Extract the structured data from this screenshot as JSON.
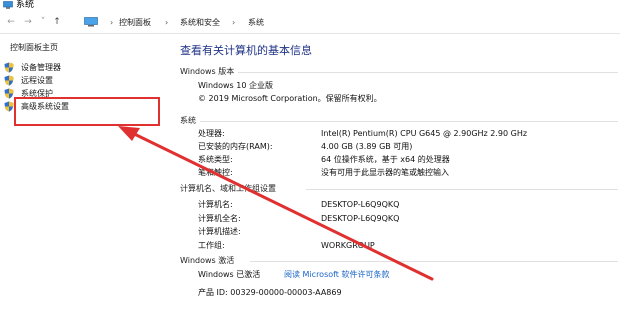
{
  "window": {
    "title": "系统"
  },
  "nav": {
    "back": "←",
    "forward": "→",
    "recent": "˅",
    "up": "↑",
    "breadcrumbs": [
      "控制面板",
      "系统和安全",
      "系统"
    ],
    "separator": "›"
  },
  "sidebar": {
    "home": "控制面板主页",
    "items": [
      {
        "label": "设备管理器"
      },
      {
        "label": "远程设置"
      },
      {
        "label": "系统保护"
      },
      {
        "label": "高级系统设置"
      }
    ]
  },
  "main": {
    "heading": "查看有关计算机的基本信息",
    "edition": {
      "section": "Windows 版本",
      "name": "Windows 10 企业版",
      "copyright": "© 2019 Microsoft Corporation。保留所有权利。"
    },
    "system": {
      "section": "系统",
      "rows": [
        {
          "key": "处理器:",
          "value": "Intel(R) Pentium(R) CPU G645 @ 2.90GHz   2.90 GHz"
        },
        {
          "key": "已安装的内存(RAM):",
          "value": "4.00 GB (3.89 GB 可用)"
        },
        {
          "key": "系统类型:",
          "value": "64 位操作系统，基于 x64 的处理器"
        },
        {
          "key": "笔和触控:",
          "value": "没有可用于此显示器的笔或触控输入"
        }
      ]
    },
    "computer": {
      "section": "计算机名、域和工作组设置",
      "rows": [
        {
          "key": "计算机名:",
          "value": "DESKTOP-L6Q9QKQ"
        },
        {
          "key": "计算机全名:",
          "value": "DESKTOP-L6Q9QKQ"
        },
        {
          "key": "计算机描述:",
          "value": ""
        },
        {
          "key": "工作组:",
          "value": "WORKGROUP"
        }
      ]
    },
    "activation": {
      "section": "Windows 激活",
      "status": "Windows 已激活",
      "link": "阅读 Microsoft 软件许可条款",
      "product_id": "产品 ID: 00329-00000-00003-AA869"
    }
  },
  "annotation": {
    "color": "#e03030"
  }
}
